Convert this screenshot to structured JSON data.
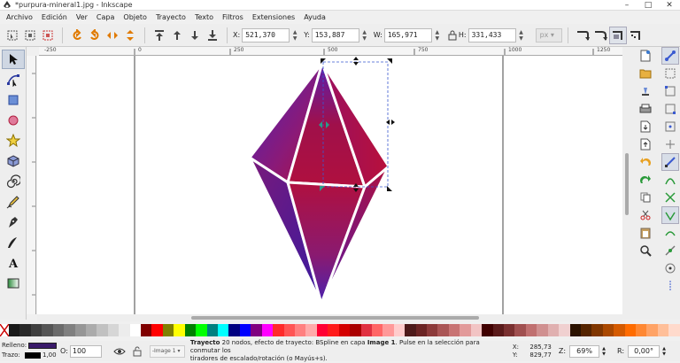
{
  "window": {
    "title": "*purpura-mineral1.jpg - Inkscape"
  },
  "menu": [
    "Archivo",
    "Edición",
    "Ver",
    "Capa",
    "Objeto",
    "Trayecto",
    "Texto",
    "Filtros",
    "Extensiones",
    "Ayuda"
  ],
  "toolbar": {
    "x_label": "X:",
    "x_value": "521,370",
    "y_label": "Y:",
    "y_value": "153,887",
    "w_label": "W:",
    "w_value": "165,971",
    "h_label": "H:",
    "h_value": "331,433",
    "unit": "px"
  },
  "ruler": {
    "h_labels": [
      "-250",
      "0",
      "250",
      "500",
      "750",
      "1000",
      "1250"
    ]
  },
  "palette": {
    "colors": [
      "#1a1a1a",
      "#2a2a2a",
      "#3f3f3f",
      "#555555",
      "#6b6b6b",
      "#808080",
      "#969696",
      "#ababab",
      "#c1c1c1",
      "#d6d6d6",
      "#ececec",
      "#ffffff",
      "#800000",
      "#ff0000",
      "#808000",
      "#ffff00",
      "#008000",
      "#00ff00",
      "#008080",
      "#00ffff",
      "#000080",
      "#0000ff",
      "#800080",
      "#ff00ff",
      "#ff2a2a",
      "#ff5555",
      "#ff8080",
      "#ffaaaa",
      "#ff0033",
      "#ff1a1a",
      "#d40000",
      "#aa0000",
      "#e03040",
      "#ff6666",
      "#ff9999",
      "#ffcccc",
      "#4d1a1a",
      "#6b2424",
      "#8c3a3a",
      "#aa5555",
      "#c87373",
      "#e29a9a",
      "#f2c4c4",
      "#400000",
      "#5a1a1a",
      "#7a3030",
      "#a05050",
      "#c07070",
      "#d09090",
      "#e0b0b0",
      "#f0d0d0",
      "#2b1200",
      "#552400",
      "#803600",
      "#aa4800",
      "#d45a00",
      "#ff6c00",
      "#ff8833",
      "#ffa366",
      "#ffbf99",
      "#ffdacc"
    ]
  },
  "status": {
    "fill_label": "Relleno:",
    "stroke_label": "Trazo:",
    "stroke_width": "1,00",
    "opacity_label": "O:",
    "opacity_value": "100",
    "layer_value": "-Image 1",
    "message_bold": "Trayecto",
    "message_line1": " 20 nodos, efecto de trayecto: BSpline en capa ",
    "message_layer": "Image 1",
    "message_line1_end": ". Pulse en la selección para conmutar los",
    "message_line2": "tiradores de escalado/rotación (o Mayús+s).",
    "x_label": "X:",
    "x_value": "285,73",
    "y_label": "Y:",
    "y_value": "829,77",
    "zoom_label": "Z:",
    "zoom_value": "69%",
    "rotation_label": "R:",
    "rotation_value": "0,00°"
  },
  "colors": {
    "gem_purple": "#5a1fb0",
    "gem_crimson": "#b0103f",
    "selection_fill": "#3a1a6a"
  }
}
